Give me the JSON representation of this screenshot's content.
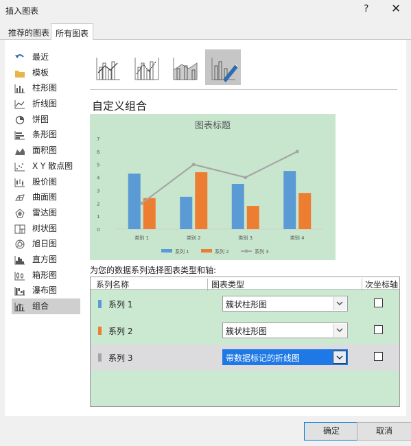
{
  "window": {
    "title": "插入图表",
    "help": "?",
    "close": "✕"
  },
  "tabs": [
    {
      "label": "推荐的图表",
      "active": false
    },
    {
      "label": "所有图表",
      "active": true
    }
  ],
  "sidebar": {
    "items": [
      {
        "label": "最近",
        "icon": "undo-arrow-icon"
      },
      {
        "label": "模板",
        "icon": "folder-icon"
      },
      {
        "label": "柱形图",
        "icon": "column-chart-icon"
      },
      {
        "label": "折线图",
        "icon": "line-chart-icon"
      },
      {
        "label": "饼图",
        "icon": "pie-chart-icon"
      },
      {
        "label": "条形图",
        "icon": "bar-chart-icon"
      },
      {
        "label": "面积图",
        "icon": "area-chart-icon"
      },
      {
        "label": "X Y 散点图",
        "icon": "scatter-chart-icon"
      },
      {
        "label": "股价图",
        "icon": "stock-chart-icon"
      },
      {
        "label": "曲面图",
        "icon": "surface-chart-icon"
      },
      {
        "label": "雷达图",
        "icon": "radar-chart-icon"
      },
      {
        "label": "树状图",
        "icon": "treemap-chart-icon"
      },
      {
        "label": "旭日图",
        "icon": "sunburst-chart-icon"
      },
      {
        "label": "直方图",
        "icon": "histogram-chart-icon"
      },
      {
        "label": "箱形图",
        "icon": "box-whisker-chart-icon"
      },
      {
        "label": "瀑布图",
        "icon": "waterfall-chart-icon"
      },
      {
        "label": "组合",
        "icon": "combo-chart-icon",
        "active": true
      }
    ]
  },
  "subtypes": [
    {
      "icon": "clustered-column-line-icon",
      "selected": false
    },
    {
      "icon": "clustered-column-line-secondary-axis-icon",
      "selected": false
    },
    {
      "icon": "stacked-area-clustered-column-icon",
      "selected": false
    },
    {
      "icon": "custom-combination-icon",
      "selected": true
    }
  ],
  "combo_title": "自定义组合",
  "chart_data": {
    "type": "bar",
    "title": "图表标题",
    "categories": [
      "类别 1",
      "类别 2",
      "类别 3",
      "类别 4"
    ],
    "series": [
      {
        "name": "系列 1",
        "type": "bar",
        "color": "#5b9bd5",
        "values": [
          4.3,
          2.5,
          3.5,
          4.5
        ]
      },
      {
        "name": "系列 2",
        "type": "bar",
        "color": "#ed7d31",
        "values": [
          2.4,
          4.4,
          1.8,
          2.8
        ]
      },
      {
        "name": "系列 3",
        "type": "line",
        "color": "#a5a5a5",
        "values": [
          2,
          5,
          4,
          6
        ]
      }
    ],
    "yticks": [
      "0",
      "1",
      "2",
      "3",
      "4",
      "5",
      "6",
      "7"
    ],
    "ylim": [
      0,
      7
    ],
    "legend_position": "bottom",
    "background": "#c7e6cd"
  },
  "series_instruction": "为您的数据系列选择图表类型和轴:",
  "grid": {
    "headers": {
      "name": "系列名称",
      "type": "图表类型",
      "secondary": "次坐标轴"
    },
    "rows": [
      {
        "name": "系列 1",
        "color": "#5b9bd5",
        "chart_type": "簇状柱形图",
        "secondary": false,
        "selected": false
      },
      {
        "name": "系列 2",
        "color": "#ed7d31",
        "chart_type": "簇状柱形图",
        "secondary": false,
        "selected": false
      },
      {
        "name": "系列 3",
        "color": "#a5a5a5",
        "chart_type": "带数据标记的折线图",
        "secondary": false,
        "selected": true
      }
    ]
  },
  "footer": {
    "ok": "确定",
    "cancel": "取消"
  }
}
